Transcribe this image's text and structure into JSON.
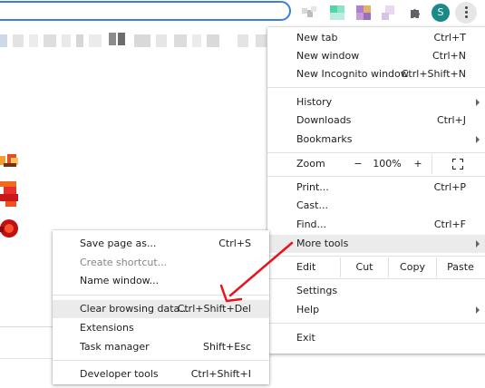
{
  "toolbar": {
    "avatar_letter": "S",
    "extensions": [
      "blurred-extension-icon",
      "teal-extension-icon",
      "purple-extension-icon",
      "lavender-extension-icon"
    ],
    "colors": {
      "omnibox_border": "#3c7ee0",
      "avatar_bg": "#1a8a88"
    }
  },
  "main_menu": {
    "new_tab": {
      "label": "New tab",
      "shortcut": "Ctrl+T"
    },
    "new_window": {
      "label": "New window",
      "shortcut": "Ctrl+N"
    },
    "new_incognito": {
      "label": "New Incognito window",
      "shortcut": "Ctrl+Shift+N"
    },
    "history": {
      "label": "History"
    },
    "downloads": {
      "label": "Downloads",
      "shortcut": "Ctrl+J"
    },
    "bookmarks": {
      "label": "Bookmarks"
    },
    "zoom": {
      "label": "Zoom",
      "minus": "−",
      "value": "100%",
      "plus": "+"
    },
    "print": {
      "label": "Print...",
      "shortcut": "Ctrl+P"
    },
    "cast": {
      "label": "Cast..."
    },
    "find": {
      "label": "Find...",
      "shortcut": "Ctrl+F"
    },
    "more_tools": {
      "label": "More tools"
    },
    "edit": {
      "label": "Edit",
      "cut": "Cut",
      "copy": "Copy",
      "paste": "Paste"
    },
    "settings": {
      "label": "Settings"
    },
    "help": {
      "label": "Help"
    },
    "exit": {
      "label": "Exit"
    }
  },
  "sub_menu": {
    "save_page": {
      "label": "Save page as...",
      "shortcut": "Ctrl+S"
    },
    "create_shortcut": {
      "label": "Create shortcut..."
    },
    "name_window": {
      "label": "Name window..."
    },
    "clear_browsing": {
      "label": "Clear browsing data...",
      "shortcut": "Ctrl+Shift+Del"
    },
    "extensions": {
      "label": "Extensions"
    },
    "task_manager": {
      "label": "Task manager",
      "shortcut": "Shift+Esc"
    },
    "developer_tools": {
      "label": "Developer tools",
      "shortcut": "Ctrl+Shift+I"
    }
  },
  "annotation": {
    "color": "#e8141b",
    "icon": "red-arrow-annotation"
  }
}
